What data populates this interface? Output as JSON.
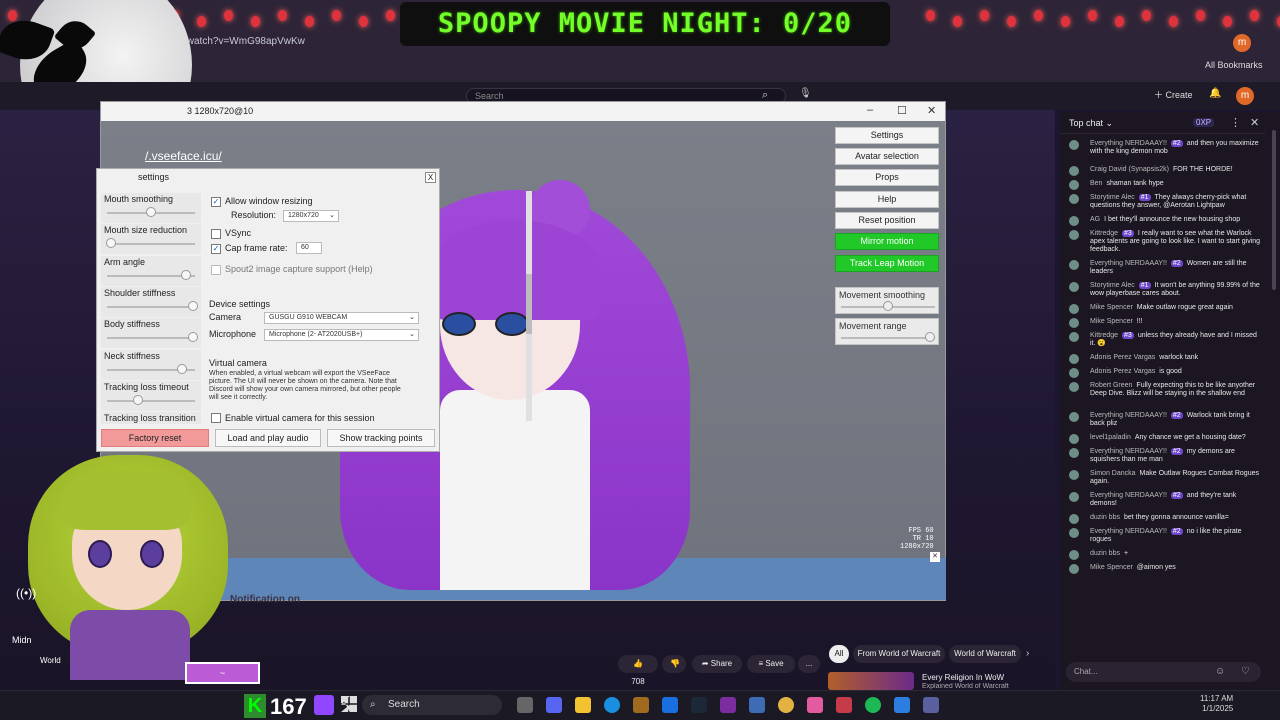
{
  "browser": {
    "url": "/watch?v=WmG98apVwKw",
    "bookmarks_label": "All Bookmarks"
  },
  "overlay": {
    "title": "SPOOPY MOVIE NIGHT: 0/20"
  },
  "youtube": {
    "search_placeholder": "Search",
    "create_label": "Create",
    "avatar_letter": "m"
  },
  "vseeface": {
    "window_title": "3 1280x720@10",
    "url": "/.vseeface.icu/",
    "fps_lines": [
      "FPS 60",
      "TR 10",
      "1280x720"
    ],
    "right_buttons": [
      "Settings",
      "Avatar selection",
      "Props",
      "Help",
      "Reset position"
    ],
    "green_buttons": [
      "Mirror motion",
      "Track Leap Motion"
    ],
    "right_sliders": [
      {
        "label": "Movement smoothing",
        "value": 0.5
      },
      {
        "label": "Movement range",
        "value": 0.95
      }
    ],
    "settings": {
      "title": "settings",
      "close": "X",
      "sliders": [
        {
          "label": "Mouth smoothing",
          "value": 0.5
        },
        {
          "label": "Mouth size reduction",
          "value": 0.05
        },
        {
          "label": "Arm angle",
          "value": 0.9
        },
        {
          "label": "Shoulder stiffness",
          "value": 0.98
        },
        {
          "label": "Body stiffness",
          "value": 0.98
        },
        {
          "label": "Neck stiffness",
          "value": 0.85
        },
        {
          "label": "Tracking loss timeout",
          "value": 0.35
        },
        {
          "label": "Tracking loss transition",
          "value": 0.5
        }
      ],
      "allow_resizing": "Allow window resizing",
      "resolution_label": "Resolution:",
      "resolution_value": "1280x720",
      "vsync": "VSync",
      "cap_frame_rate": "Cap frame rate:",
      "cap_value": "60",
      "spout": "Spout2 image capture support",
      "spout_help": "(Help)",
      "device_settings": "Device settings",
      "camera_label": "Camera",
      "camera_value": "GUSGU G910 WEBCAM",
      "mic_label": "Microphone",
      "mic_value": "Microphone (2- AT2020USB+)",
      "virtual_camera": "Virtual camera",
      "virtual_desc": "When enabled, a virtual webcam will export the VSeeFace picture. The UI will never be shown on the camera. Note that Discord will show your own camera mirrored, but other people will see it correctly.",
      "enable_virtual": "Enable virtual camera for this session",
      "factory_reset": "Factory reset",
      "load_audio": "Load and play audio",
      "show_points": "Show tracking points"
    }
  },
  "chat": {
    "header": "Top chat",
    "points": "0XP",
    "input_placeholder": "Chat...",
    "messages": [
      {
        "name": "Everything NERDAAAY!!",
        "badge": "#2",
        "text": "and then you maximize with the king demon mob"
      },
      {
        "name": "Craig David (Synapsis2k)",
        "badge": "",
        "text": "FOR THE HORDE!"
      },
      {
        "name": "Ben",
        "badge": "",
        "text": "shaman tank hype"
      },
      {
        "name": "Storytime Alec",
        "badge": "#1",
        "text": "They always cherry-pick what questions they answer, @Aerotan Lightpaw"
      },
      {
        "name": "AG",
        "badge": "",
        "text": "I bet they'll announce the new housing shop"
      },
      {
        "name": "Kittredge",
        "badge": "#3",
        "text": "I really want to see what the Warlock apex talents are going to look like. I want to start giving feedback."
      },
      {
        "name": "Everything NERDAAAY!!",
        "badge": "#2",
        "text": "Women are still the leaders"
      },
      {
        "name": "Storytime Alec",
        "badge": "#1",
        "text": "It won't be anything 99.99% of the wow playerbase cares about."
      },
      {
        "name": "Mike Spencer",
        "badge": "",
        "text": "Make outlaw rogue great again"
      },
      {
        "name": "Mike Spencer",
        "badge": "",
        "text": "!!!"
      },
      {
        "name": "Kittredge",
        "badge": "#3",
        "text": "unless they already have and I missed it. 😮"
      },
      {
        "name": "Adonis Perez Vargas",
        "badge": "",
        "text": "warlock tank"
      },
      {
        "name": "Adonis Perez Vargas",
        "badge": "",
        "text": "is good"
      },
      {
        "name": "Robert Green",
        "badge": "",
        "text": "Fully expecting this to be like anyother Deep Dive. Blizz will be staying in the shallow end"
      },
      {
        "name": "Everything NERDAAAY!!",
        "badge": "#2",
        "text": "Warlock tank bring it back pliz"
      },
      {
        "name": "level1paladin",
        "badge": "",
        "text": "Any chance we get a housing date?"
      },
      {
        "name": "Everything NERDAAAY!!",
        "badge": "#2",
        "text": "my demons are squishers than me man"
      },
      {
        "name": "Simon Dancka",
        "badge": "",
        "text": "Make Outlaw Rogues Combat Rogues again."
      },
      {
        "name": "Everything NERDAAAY!!",
        "badge": "#2",
        "text": "and they're tank demons!"
      },
      {
        "name": "duzin bbs",
        "badge": "",
        "text": "bet they gonna announce vanilla="
      },
      {
        "name": "Everything NERDAAAY!!",
        "badge": "#2",
        "text": "no i like the pirate rogues"
      },
      {
        "name": "duzin bbs",
        "badge": "",
        "text": "+"
      },
      {
        "name": "Mike Spencer",
        "badge": "",
        "text": "@aimon yes"
      }
    ]
  },
  "video_actions": {
    "likes": "708",
    "share": "Share",
    "save": "Save",
    "more": "...",
    "tabs": [
      "All",
      "From World of Warcraft",
      "World of Warcraft"
    ],
    "next_video_title": "Every Religion In WoW",
    "next_video_sub": "Explained World of Warcraft"
  },
  "stream": {
    "follower_count": "167",
    "channel_label": "Midn",
    "world_label": "World",
    "notification_text": "Notification on"
  },
  "taskbar": {
    "search_label": "Search",
    "time": "11:17 AM",
    "date": "1/1/2025"
  },
  "colors": {
    "overlay_green": "#74ff2a",
    "mirror_green": "#21c928",
    "factory_reset_red": "#f29a9a",
    "chat_badge": "#6d47c9"
  }
}
